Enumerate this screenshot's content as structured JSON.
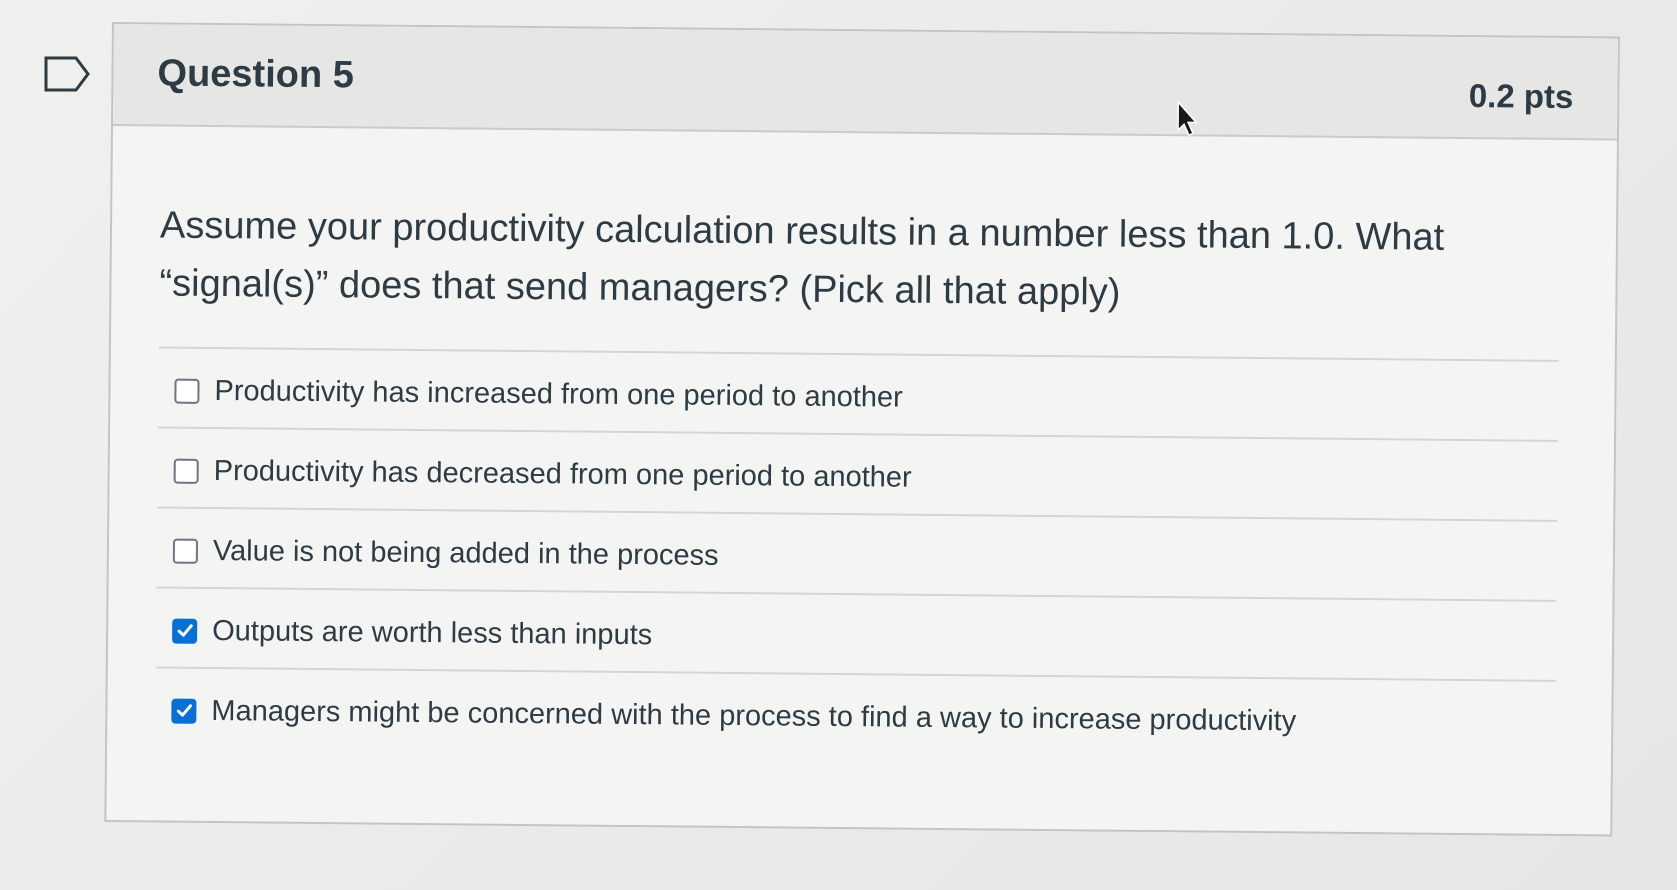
{
  "question": {
    "title": "Question 5",
    "points": "0.2 pts",
    "text": "Assume your productivity calculation results in a number less than 1.0.  What “signal(s)” does that send managers? (Pick all that apply)"
  },
  "answers": [
    {
      "label": "Productivity has increased from one period to another",
      "checked": false
    },
    {
      "label": "Productivity has decreased from one period to another",
      "checked": false
    },
    {
      "label": "Value is not being added in the process",
      "checked": false
    },
    {
      "label": "Outputs are worth less than inputs",
      "checked": true
    },
    {
      "label": "Managers might be concerned with the process to find a way to increase productivity",
      "checked": true
    }
  ],
  "icons": {
    "flag": "bookmark-flag-icon",
    "cursor": "mouse-pointer-icon",
    "check": "checkmark-icon"
  },
  "colors": {
    "accent": "#0770d8",
    "text": "#2d3b45",
    "header_bg": "#e6e6e5",
    "border": "#c2c5c7"
  }
}
